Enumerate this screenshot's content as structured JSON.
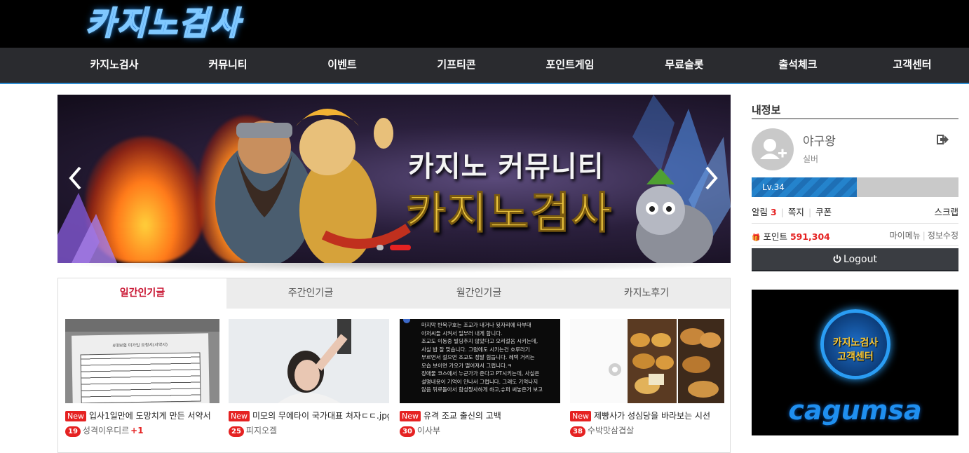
{
  "header": {
    "logo_text": "카지노검사"
  },
  "nav": {
    "items": [
      {
        "label": "카지노검사"
      },
      {
        "label": "커뮤니티"
      },
      {
        "label": "이벤트"
      },
      {
        "label": "기프티콘"
      },
      {
        "label": "포인트게임"
      },
      {
        "label": "무료슬롯"
      },
      {
        "label": "출석체크"
      },
      {
        "label": "고객센터"
      }
    ]
  },
  "banner": {
    "line1": "카지노 커뮤니티",
    "line2": "카지노검사",
    "prev_icon": "chevron-left-icon",
    "next_icon": "chevron-right-icon"
  },
  "tabs": [
    {
      "label": "일간인기글",
      "active": true
    },
    {
      "label": "주간인기글"
    },
    {
      "label": "월간인기글"
    },
    {
      "label": "카지노후기"
    }
  ],
  "posts": [
    {
      "badge": "New",
      "title": "입사1일만에 도망치게 만든 서약서",
      "level": "19",
      "author": "성격이우디르",
      "extra": "+1"
    },
    {
      "badge": "New",
      "title": "미모의 무에타이 국가대표 처자ㄷㄷ.jpg",
      "level": "25",
      "author": "피지오겔"
    },
    {
      "badge": "New",
      "title": "유격 조교 출신의 고백",
      "level": "30",
      "author": "이사부"
    },
    {
      "badge": "New",
      "title": "제빵사가 성심당을 바라보는 시선",
      "level": "38",
      "author": "수박맛삼겹살"
    }
  ],
  "post3_text": [
    "마지막 반복구호는 조교가 내거나 뒷자리에 타부대",
    "아저씨들 시켜서 일부러 내게 합니다.",
    "조교도 이동중 빌딩추지 않았다고 오리걸음 시키는데,",
    "사실 밥 잘 맞습니다. 그럼에도 시키는건 호루라기",
    "부르면서 걸으면 조교도 정말 힘듭니다. 혜택 거리는",
    "모습 보이면 가오가 떨어져서 그럽니다.ㅋ",
    "장애물 코스에서 누군가가 준다고 PT시키는데, 사실은",
    "설명내용이 기억이 안나서 그럽니다. 그래도 기억나지",
    "않음 뒤로돌아서 함성짱사하게 하고,슈퍼 써놓은거 보고"
  ],
  "post1_doc_title": "4대보험 미가입 요청서(서약서)",
  "sidebar": {
    "title": "내정보",
    "username": "야구왕",
    "rank": "실버",
    "level_label": "Lv.34",
    "level_progress": 0.51,
    "alerts_label": "알림",
    "alerts_count": "3",
    "messages_label": "쪽지",
    "coupons_label": "쿠폰",
    "scrap_label": "스크랩",
    "points_label": "포인트",
    "points_value": "591,304",
    "mypage_label": "마이메뉴",
    "edit_label": "정보수정",
    "logout_label": "Logout",
    "support_line1": "카지노검사",
    "support_line2": "고객센터",
    "support_word": "cagumsa"
  },
  "colors": {
    "accent_red": "#e52222",
    "nav_bg": "#2a2b2f",
    "nav_border": "#2e8fd4",
    "level_fill": "#1e6fb5"
  }
}
